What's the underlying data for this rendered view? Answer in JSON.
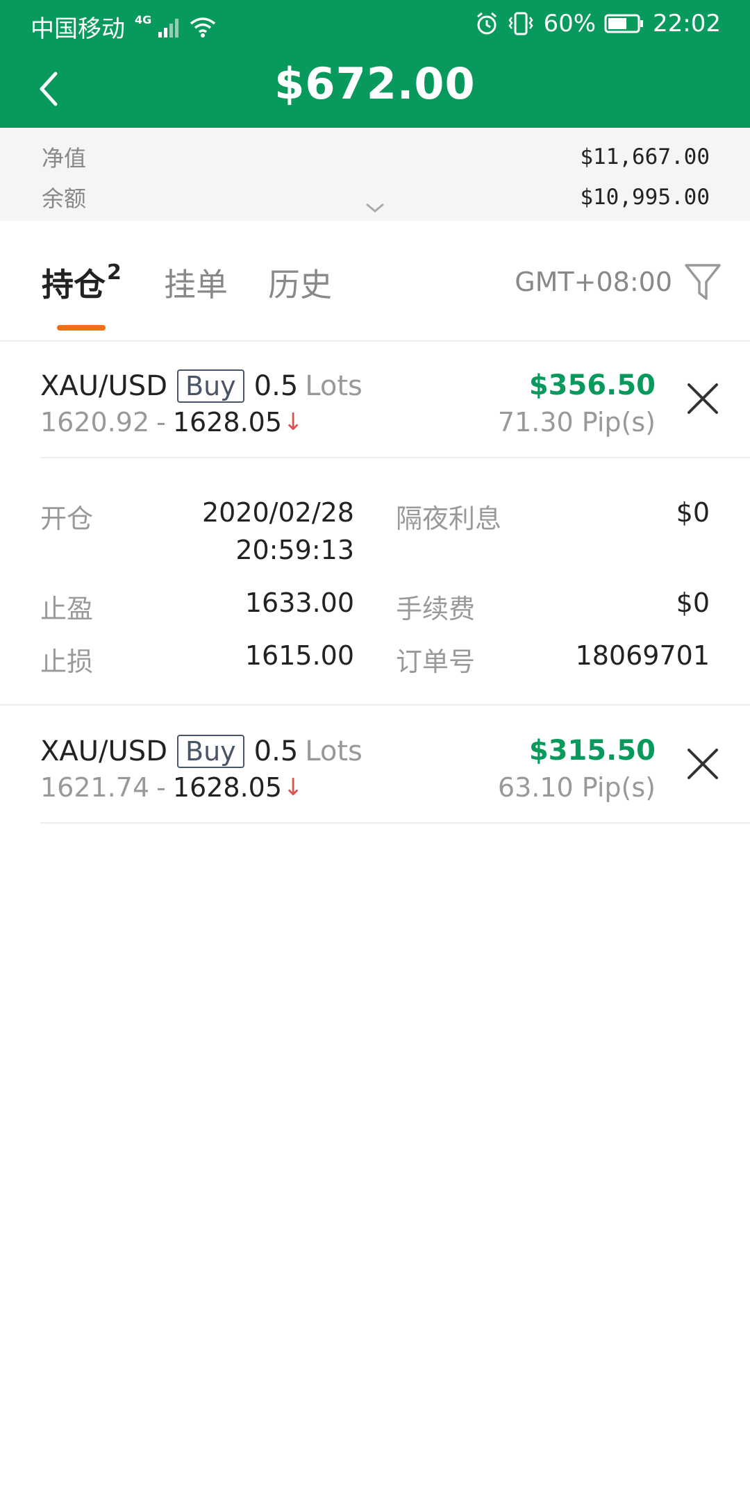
{
  "status_bar": {
    "carrier": "中国移动",
    "network": "4G",
    "battery_percent": "60%",
    "time": "22:02"
  },
  "header": {
    "title": "$672.00"
  },
  "summary": {
    "equity_label": "净值",
    "equity_value": "$11,667.00",
    "balance_label": "余额",
    "balance_value": "$10,995.00"
  },
  "tabs": {
    "positions_label": "持仓",
    "positions_count": "2",
    "pending_label": "挂单",
    "history_label": "历史",
    "timezone": "GMT+08:00"
  },
  "positions": [
    {
      "symbol": "XAU/USD",
      "side": "Buy",
      "lots": "0.5",
      "lots_unit": "Lots",
      "open_price": "1620.92",
      "separator": "-",
      "current_price": "1628.05",
      "pnl": "$356.50",
      "pips": "71.30 Pip(s)",
      "expanded": true,
      "details": {
        "open_label": "开仓",
        "open_date": "2020/02/28",
        "open_time": "20:59:13",
        "tp_label": "止盈",
        "tp_value": "1633.00",
        "sl_label": "止损",
        "sl_value": "1615.00",
        "swap_label": "隔夜利息",
        "swap_value": "$0",
        "fee_label": "手续费",
        "fee_value": "$0",
        "order_label": "订单号",
        "order_value": "18069701"
      }
    },
    {
      "symbol": "XAU/USD",
      "side": "Buy",
      "lots": "0.5",
      "lots_unit": "Lots",
      "open_price": "1621.74",
      "separator": "-",
      "current_price": "1628.05",
      "pnl": "$315.50",
      "pips": "63.10 Pip(s)",
      "expanded": false
    }
  ],
  "colors": {
    "brand_green": "#08995c",
    "tab_accent": "#f07018",
    "down_red": "#d9534f"
  }
}
